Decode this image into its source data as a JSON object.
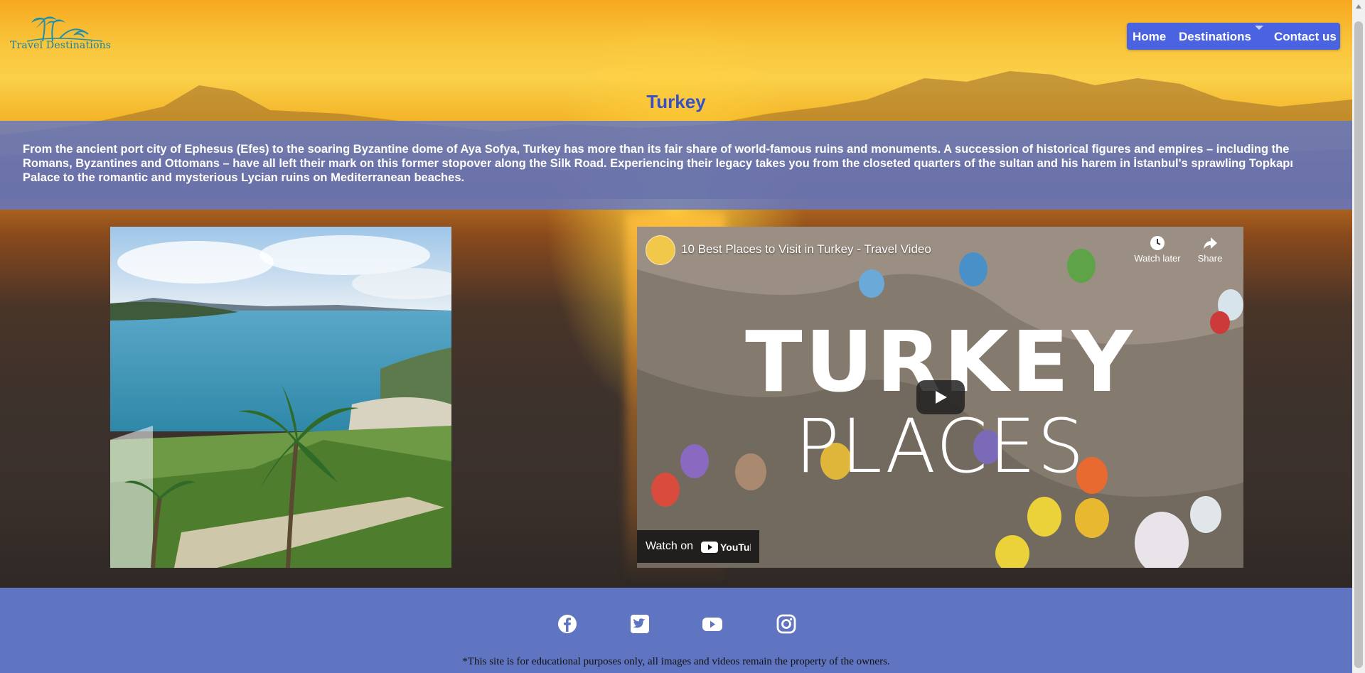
{
  "brand": {
    "logo_text": "Travel Destinations"
  },
  "nav": {
    "home": "Home",
    "destinations": "Destinations",
    "contact": "Contact us"
  },
  "page": {
    "title": "Turkey",
    "intro": "From the ancient port city of Ephesus (Efes) to the soaring Byzantine dome of Aya Sofya, Turkey has more than its fair share of world-famous ruins and monuments. A succession of historical figures and empires – including the Romans, Byzantines and Ottomans – have all left their mark on this former stopover along the Silk Road. Experiencing their legacy takes you from the closeted quarters of the sultan and his harem in İstanbul's sprawling Topkapı Palace to the romantic and mysterious Lycian ruins on Mediterranean beaches."
  },
  "video": {
    "title": "10 Best Places to Visit in Turkey - Travel Video",
    "watch_later": "Watch later",
    "share": "Share",
    "overlay_line1": "TURKEY",
    "overlay_line2": "PLACES",
    "watch_on": "Watch on",
    "youtube": "YouTube"
  },
  "footer": {
    "social": [
      "facebook-icon",
      "twitter-icon",
      "youtube-icon",
      "instagram-icon"
    ],
    "disclaimer": "*This site is for educational purposes only, all images and videos remain the property of the owners."
  },
  "colors": {
    "nav_bg": "#4a63e0",
    "title": "#3550c8",
    "band": "#6075c2"
  }
}
